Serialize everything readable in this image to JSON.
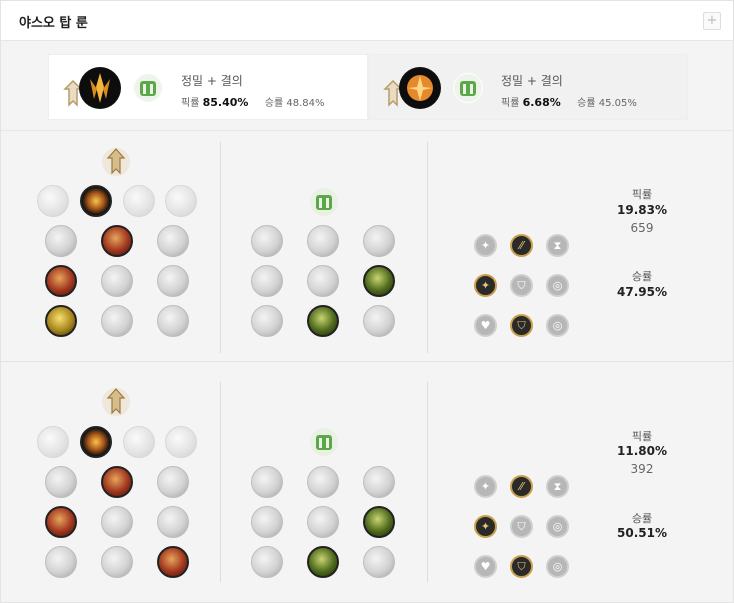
{
  "header": {
    "title": "야스오 탑 룬",
    "plus_label": "+"
  },
  "summary": [
    {
      "name": "정밀 + 결의",
      "pick_label": "픽률",
      "pick": "85.40%",
      "win_label": "승률",
      "win": "48.84%"
    },
    {
      "name": "정밀 + 결의",
      "pick_label": "픽률",
      "pick": "6.68%",
      "win_label": "승률",
      "win": "45.05%"
    }
  ],
  "builds": [
    {
      "pick_label": "픽률",
      "pick": "19.83%",
      "count": "659",
      "win_label": "승률",
      "win": "47.95%"
    },
    {
      "pick_label": "픽률",
      "pick": "11.80%",
      "count": "392",
      "win_label": "승률",
      "win": "50.51%"
    }
  ],
  "colors": {
    "precision": "#c8aa6e",
    "resolve": "#4e9a3a",
    "keystone_dark": "#111111"
  },
  "icons": {
    "precision": "precision-path-icon",
    "resolve": "resolve-path-icon",
    "keystone": "conqueror-icon",
    "keystone_alt": "fleet-footwork-icon"
  }
}
